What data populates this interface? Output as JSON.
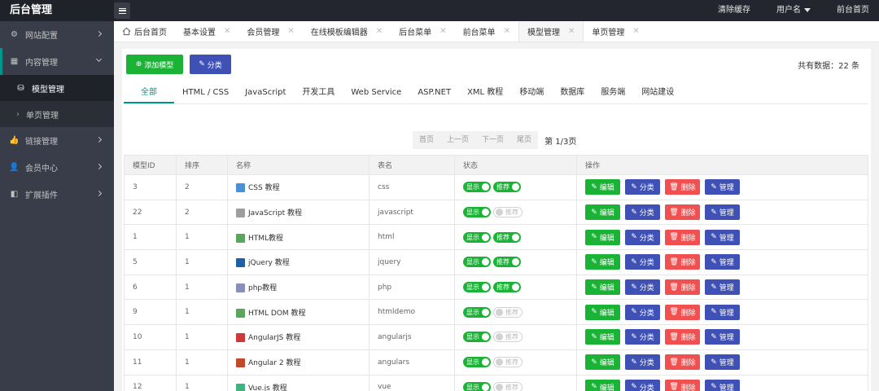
{
  "app": {
    "title": "后台管理",
    "top_right": {
      "clear_cache": "清除缓存",
      "username": "用户名",
      "front_home": "前台首页"
    }
  },
  "sidebar": {
    "items": [
      {
        "label": "网站配置",
        "icon": "gear-icon"
      },
      {
        "label": "内容管理",
        "icon": "content-icon"
      },
      {
        "label": "链接管理",
        "icon": "thumb-icon"
      },
      {
        "label": "会员中心",
        "icon": "user-icon"
      },
      {
        "label": "扩展插件",
        "icon": "plugin-icon"
      }
    ],
    "sub_items": [
      {
        "label": "模型管理",
        "icon": "model-icon"
      },
      {
        "label": "单页管理",
        "icon": "chevron-right-icon"
      }
    ]
  },
  "tabs": [
    {
      "label": "后台首页"
    },
    {
      "label": "基本设置"
    },
    {
      "label": "会员管理"
    },
    {
      "label": "在线模板编辑器"
    },
    {
      "label": "后台菜单"
    },
    {
      "label": "前台菜单"
    },
    {
      "label": "模型管理"
    },
    {
      "label": "单页管理"
    }
  ],
  "toolbar": {
    "add_label": "添加模型",
    "category_label": "分类",
    "total": "共有数据：22 条"
  },
  "categories": [
    "全部",
    "HTML / CSS",
    "JavaScript",
    "开发工具",
    "Web Service",
    "ASP.NET",
    "XML 教程",
    "移动端",
    "数据库",
    "服务端",
    "网站建设"
  ],
  "pager": {
    "first": "首页",
    "prev": "上一页",
    "next": "下一页",
    "last": "尾页",
    "info": "第 1/3页"
  },
  "table": {
    "headers": [
      "模型ID",
      "排序",
      "名称",
      "表名",
      "状态",
      "操作"
    ],
    "switch_show": "显示",
    "switch_recommend": "推荐",
    "actions": {
      "edit": "编辑",
      "category": "分类",
      "delete": "删除",
      "manage": "管理"
    },
    "rows": [
      {
        "id": "3",
        "sort": "2",
        "name": "CSS 教程",
        "table": "css",
        "show": true,
        "recommend": true,
        "icon_color": "#4a90d9"
      },
      {
        "id": "22",
        "sort": "2",
        "name": "JavaScript 教程",
        "table": "javascript",
        "show": true,
        "recommend": false,
        "icon_color": "#9e9e9e"
      },
      {
        "id": "1",
        "sort": "1",
        "name": "HTML教程",
        "table": "html",
        "show": true,
        "recommend": true,
        "icon_color": "#5aa65a"
      },
      {
        "id": "5",
        "sort": "1",
        "name": "jQuery 教程",
        "table": "jquery",
        "show": true,
        "recommend": true,
        "icon_color": "#1e5fa8"
      },
      {
        "id": "6",
        "sort": "1",
        "name": "php教程",
        "table": "php",
        "show": true,
        "recommend": true,
        "icon_color": "#8a8fb8"
      },
      {
        "id": "9",
        "sort": "1",
        "name": "HTML DOM 教程",
        "table": "htmldemo",
        "show": true,
        "recommend": false,
        "icon_color": "#5aa65a"
      },
      {
        "id": "10",
        "sort": "1",
        "name": "AngularJS 教程",
        "table": "angularjs",
        "show": true,
        "recommend": false,
        "icon_color": "#d0393a"
      },
      {
        "id": "11",
        "sort": "1",
        "name": "Angular 2 教程",
        "table": "angulars",
        "show": true,
        "recommend": false,
        "icon_color": "#c04a2a"
      },
      {
        "id": "12",
        "sort": "1",
        "name": "Vue.js 教程",
        "table": "vue",
        "show": true,
        "recommend": false,
        "icon_color": "#3fb37f"
      }
    ]
  }
}
